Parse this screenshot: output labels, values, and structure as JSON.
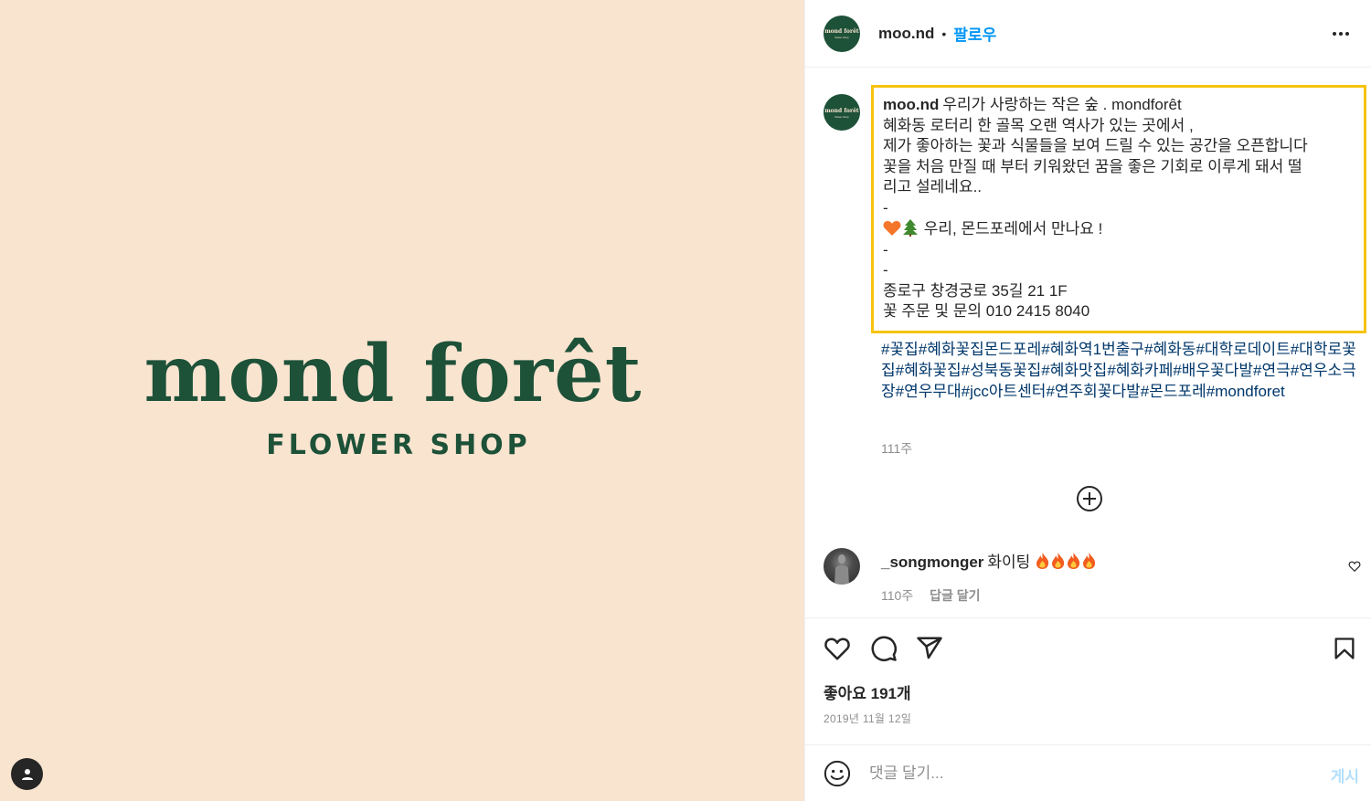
{
  "media": {
    "brand_name": "mond forêt",
    "brand_sub": "FLOWER SHOP",
    "bg_color": "#f9e4d0",
    "brand_color": "#1d5138",
    "tag_icon": "user-icon"
  },
  "header": {
    "username": "moo.nd",
    "separator": "•",
    "follow_label": "팔로우",
    "more_icon": "more-icon"
  },
  "avatar_logo": {
    "text": "mond forêt",
    "sub": "flower shop"
  },
  "caption": {
    "username": "moo.nd",
    "first_line": "우리가 사랑하는 작은 숲 . mondforêt",
    "lines": [
      "혜화동 로터리 한 골목 오랜 역사가 있는 곳에서 ,",
      "제가 좋아하는 꽃과 식물들을 보여 드릴 수 있는 공간을 오픈합니다",
      "꽃을 처음 만질 때 부터 키워왔던 꿈을 좋은 기회로 이루게 돼서 떨",
      "리고 설레네요..",
      "-"
    ],
    "emoji_line": "우리, 몬드포레에서 만나요 !",
    "lines_after": [
      "-",
      "-",
      "종로구 창경궁로 35길 21 1F",
      "꽃 주문 및 문의 010 2415 8040"
    ],
    "highlight_color": "#f7c30f"
  },
  "hashtags": "#꽃집#혜화꽃집몬드포레#혜화역1번출구#혜화동#대학로데이트#대학로꽃집#혜화꽃집#성북동꽃집#혜화맛집#혜화카페#배우꽃다발#연극#연우소극장#연우무대#jcc아트센터#연주회꽃다발#몬드포레#mondforet",
  "caption_time": "111주",
  "comment": {
    "username": "_songmonger",
    "text": "화이팅",
    "time": "110주",
    "reply_label": "답글 달기"
  },
  "likes": "좋아요 191개",
  "date": "2019년 11월 12일",
  "composer": {
    "placeholder": "댓글 달기...",
    "post_label": "게시"
  },
  "colors": {
    "link": "#0095f6",
    "hashtag": "#00376b",
    "muted": "#8e8e8e"
  }
}
